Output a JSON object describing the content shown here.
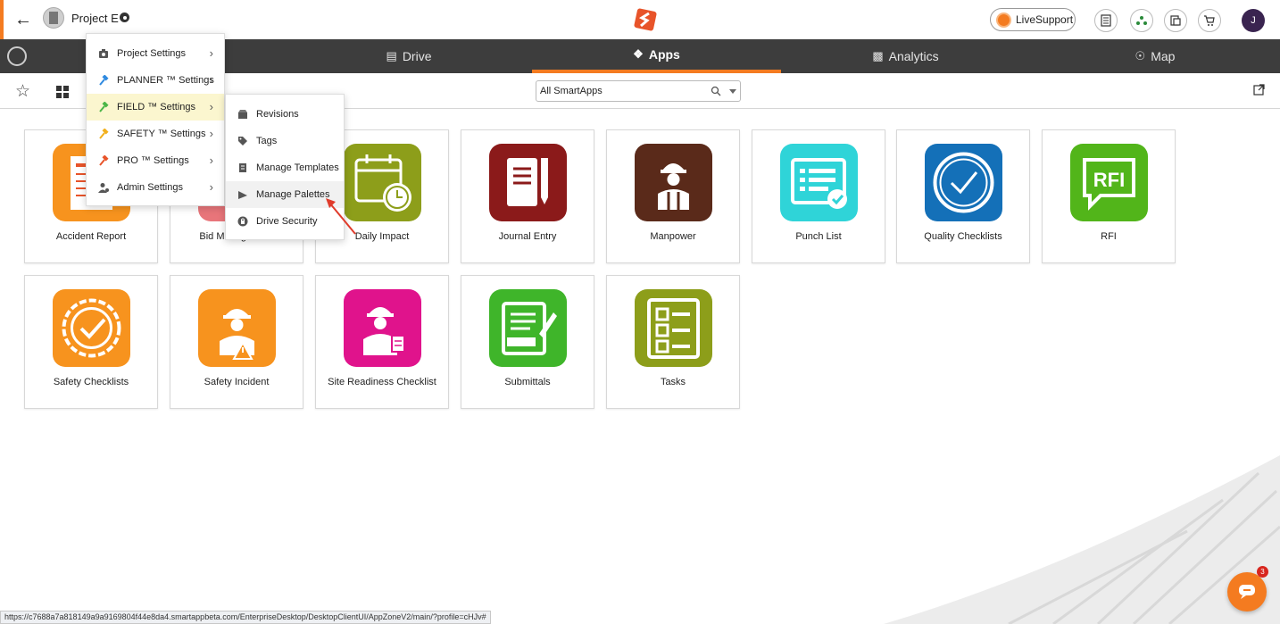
{
  "header": {
    "project_name": "Project E",
    "live_support_label": "LiveSupport",
    "user_initial": "J"
  },
  "nav": {
    "tabs": [
      {
        "label": "Drive",
        "icon": "folder-icon",
        "active": false
      },
      {
        "label": "Apps",
        "icon": "apps-icon",
        "active": true
      },
      {
        "label": "Analytics",
        "icon": "chart-icon",
        "active": false
      },
      {
        "label": "Map",
        "icon": "map-pin-icon",
        "active": false
      }
    ]
  },
  "toolbar": {
    "search_value": "All SmartApps"
  },
  "apps": [
    {
      "label": "Accident Report",
      "color": "#f7931e"
    },
    {
      "label": "Bid Management",
      "color": "#e8757a"
    },
    {
      "label": "Daily Impact",
      "color": "#8d9e1a"
    },
    {
      "label": "Journal Entry",
      "color": "#8b1a1a"
    },
    {
      "label": "Manpower",
      "color": "#5a2a1a"
    },
    {
      "label": "Punch List",
      "color": "#2fd4d8"
    },
    {
      "label": "Quality Checklists",
      "color": "#1470b8"
    },
    {
      "label": "RFI",
      "color": "#52b51a"
    },
    {
      "label": "Safety Checklists",
      "color": "#f7931e"
    },
    {
      "label": "Safety Incident",
      "color": "#f7931e"
    },
    {
      "label": "Site Readiness Checklist",
      "color": "#e0138c"
    },
    {
      "label": "Submittals",
      "color": "#3fb52a"
    },
    {
      "label": "Tasks",
      "color": "#8d9e1a"
    }
  ],
  "settings_menu": {
    "items": [
      {
        "label": "Project Settings",
        "icon": "camera-icon"
      },
      {
        "label": "PLANNER ™ Settings",
        "icon": "hammer-icon",
        "color": "#2f8ae0"
      },
      {
        "label": "FIELD ™ Settings",
        "icon": "hammer-icon",
        "color": "#4cb648"
      },
      {
        "label": "SAFETY ™ Settings",
        "icon": "hammer-icon",
        "color": "#f2b01e"
      },
      {
        "label": "PRO ™ Settings",
        "icon": "hammer-icon",
        "color": "#e8542a"
      },
      {
        "label": "Admin Settings",
        "icon": "admin-icon"
      }
    ]
  },
  "field_submenu": {
    "items": [
      {
        "label": "Revisions",
        "icon": "box-icon"
      },
      {
        "label": "Tags",
        "icon": "tag-icon"
      },
      {
        "label": "Manage Templates",
        "icon": "document-icon"
      },
      {
        "label": "Manage Palettes",
        "icon": "palette-icon"
      },
      {
        "label": "Drive Security",
        "icon": "shield-icon"
      }
    ]
  },
  "status_bar": {
    "url": "https://c7688a7a818149a9a9169804f44e8da4.smartappbeta.com/EnterpriseDesktop/DesktopClientUI/AppZoneV2/main/?profile=cHJv#"
  },
  "chat": {
    "badge_count": "3"
  },
  "colors": {
    "accent": "#f47b20",
    "nav_bg": "#3d3d3d",
    "highlight": "#fbf6cf"
  }
}
